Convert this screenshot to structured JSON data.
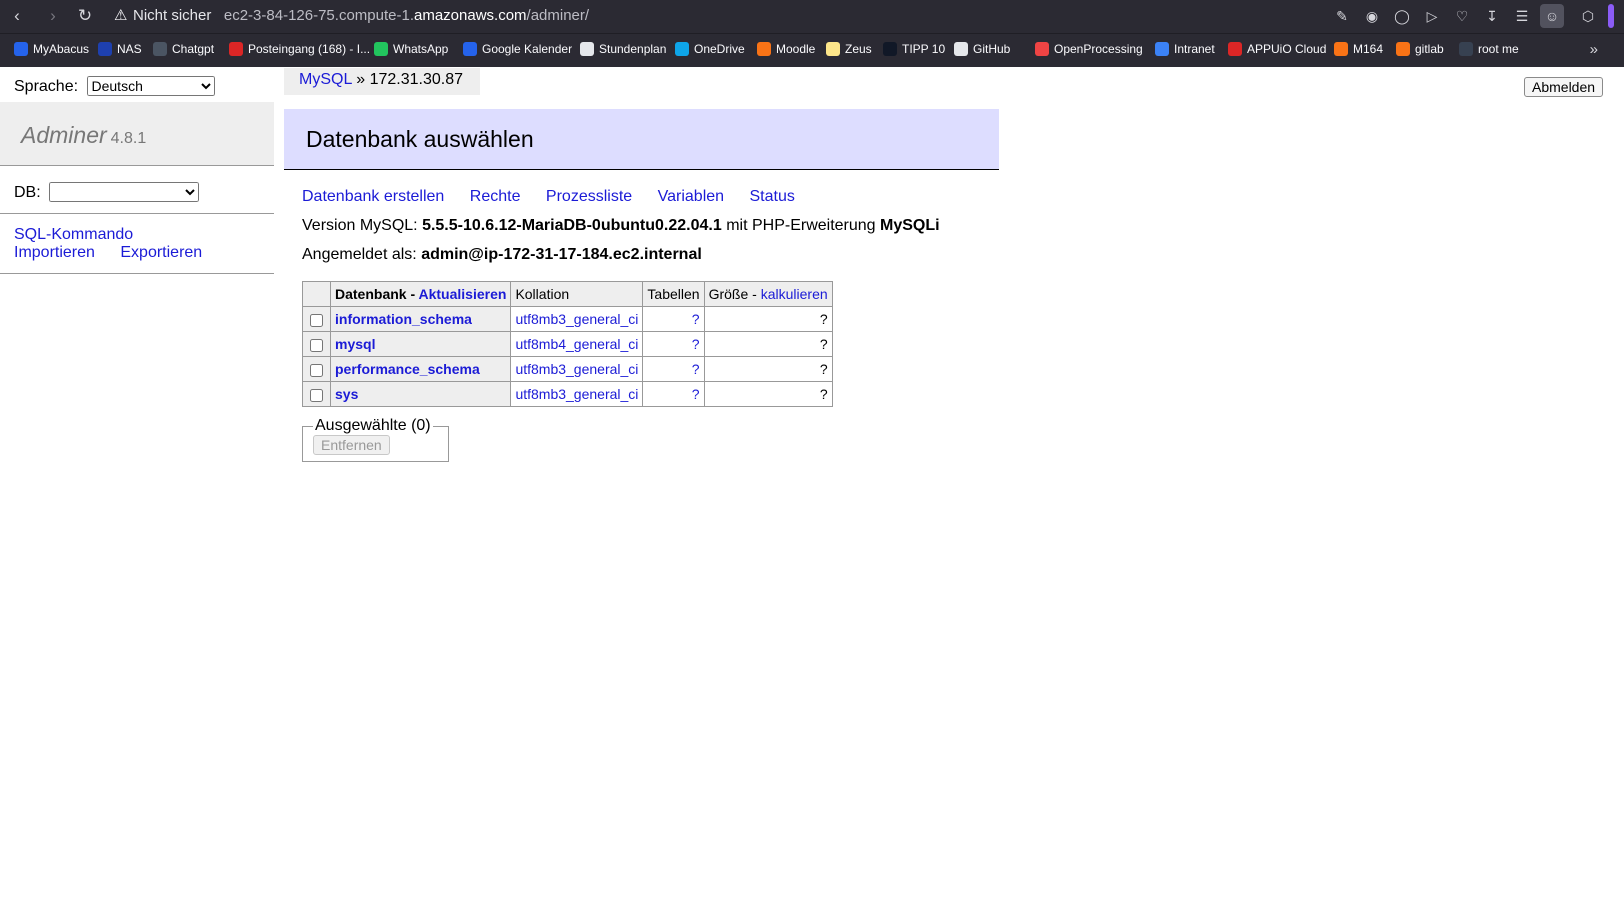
{
  "browser": {
    "security_warning": "Nicht sicher",
    "url_prefix": "ec2-3-84-126-75.compute-1.",
    "url_host": "amazonaws.com",
    "url_path": "/adminer/",
    "bookmarks": [
      {
        "label": "MyAbacus",
        "icon": "abacus-icon",
        "color": "#2563eb"
      },
      {
        "label": "NAS",
        "icon": "nas-icon",
        "color": "#1e40af"
      },
      {
        "label": "Chatgpt",
        "icon": "chatgpt-icon",
        "color": "#4b5563"
      },
      {
        "label": "Posteingang (168) - I...",
        "icon": "gmail-icon",
        "color": "#dc2626"
      },
      {
        "label": "WhatsApp",
        "icon": "whatsapp-icon",
        "color": "#22c55e"
      },
      {
        "label": "Google Kalender",
        "icon": "calendar-icon",
        "color": "#2563eb"
      },
      {
        "label": "Stundenplan",
        "icon": "clock-icon",
        "color": "#e5e7eb"
      },
      {
        "label": "OneDrive",
        "icon": "onedrive-icon",
        "color": "#0ea5e9"
      },
      {
        "label": "Moodle",
        "icon": "moodle-icon",
        "color": "#f97316"
      },
      {
        "label": "Zeus",
        "icon": "zeus-icon",
        "color": "#fde68a"
      },
      {
        "label": "TIPP 10",
        "icon": "tipp10-icon",
        "color": "#111827"
      },
      {
        "label": "GitHub",
        "icon": "github-icon",
        "color": "#e5e7eb"
      },
      {
        "label": "OpenProcessing",
        "icon": "openprocessing-icon",
        "color": "#ef4444"
      },
      {
        "label": "Intranet",
        "icon": "intranet-icon",
        "color": "#3b82f6"
      },
      {
        "label": "APPUiO Cloud",
        "icon": "appuio-icon",
        "color": "#dc2626"
      },
      {
        "label": "M164",
        "icon": "gitlab-icon",
        "color": "#f97316"
      },
      {
        "label": "gitlab",
        "icon": "gitlab-icon",
        "color": "#f97316"
      },
      {
        "label": "root me",
        "icon": "rootme-icon",
        "color": "#374151"
      }
    ]
  },
  "adminer": {
    "lang_label": "Sprache:",
    "lang_selected": "Deutsch",
    "logout_label": "Abmelden",
    "brand_name": "Adminer",
    "brand_version": "4.8.1",
    "db_label": "DB:",
    "sql_command": "SQL-Kommando",
    "import": "Importieren",
    "export": "Exportieren",
    "breadcrumb_link": "MySQL",
    "breadcrumb_sep": "»",
    "breadcrumb_server": "172.31.30.87",
    "page_title": "Datenbank auswählen",
    "nav": {
      "create_db": "Datenbank erstellen",
      "privileges": "Rechte",
      "processlist": "Prozessliste",
      "variables": "Variablen",
      "status": "Status"
    },
    "version_prefix": "Version MySQL:",
    "version_value": "5.5.5-10.6.12-MariaDB-0ubuntu0.22.04.1",
    "version_mid": "mit PHP-Erweiterung",
    "version_ext": "MySQLi",
    "logged_prefix": "Angemeldet als:",
    "logged_user": "admin@ip-172-31-17-184.ec2.internal",
    "table": {
      "col_db": "Datenbank",
      "col_db_sep": " - ",
      "col_refresh": "Aktualisieren",
      "col_collation": "Kollation",
      "col_tables": "Tabellen",
      "col_size": "Größe",
      "col_size_sep": " - ",
      "col_calc": "kalkulieren",
      "rows": [
        {
          "name": "information_schema",
          "collation": "utf8mb3_general_ci",
          "tables": "?",
          "size": "?"
        },
        {
          "name": "mysql",
          "collation": "utf8mb4_general_ci",
          "tables": "?",
          "size": "?"
        },
        {
          "name": "performance_schema",
          "collation": "utf8mb3_general_ci",
          "tables": "?",
          "size": "?"
        },
        {
          "name": "sys",
          "collation": "utf8mb3_general_ci",
          "tables": "?",
          "size": "?"
        }
      ]
    },
    "selected_legend": "Ausgewählte (0)",
    "remove_button": "Entfernen"
  }
}
